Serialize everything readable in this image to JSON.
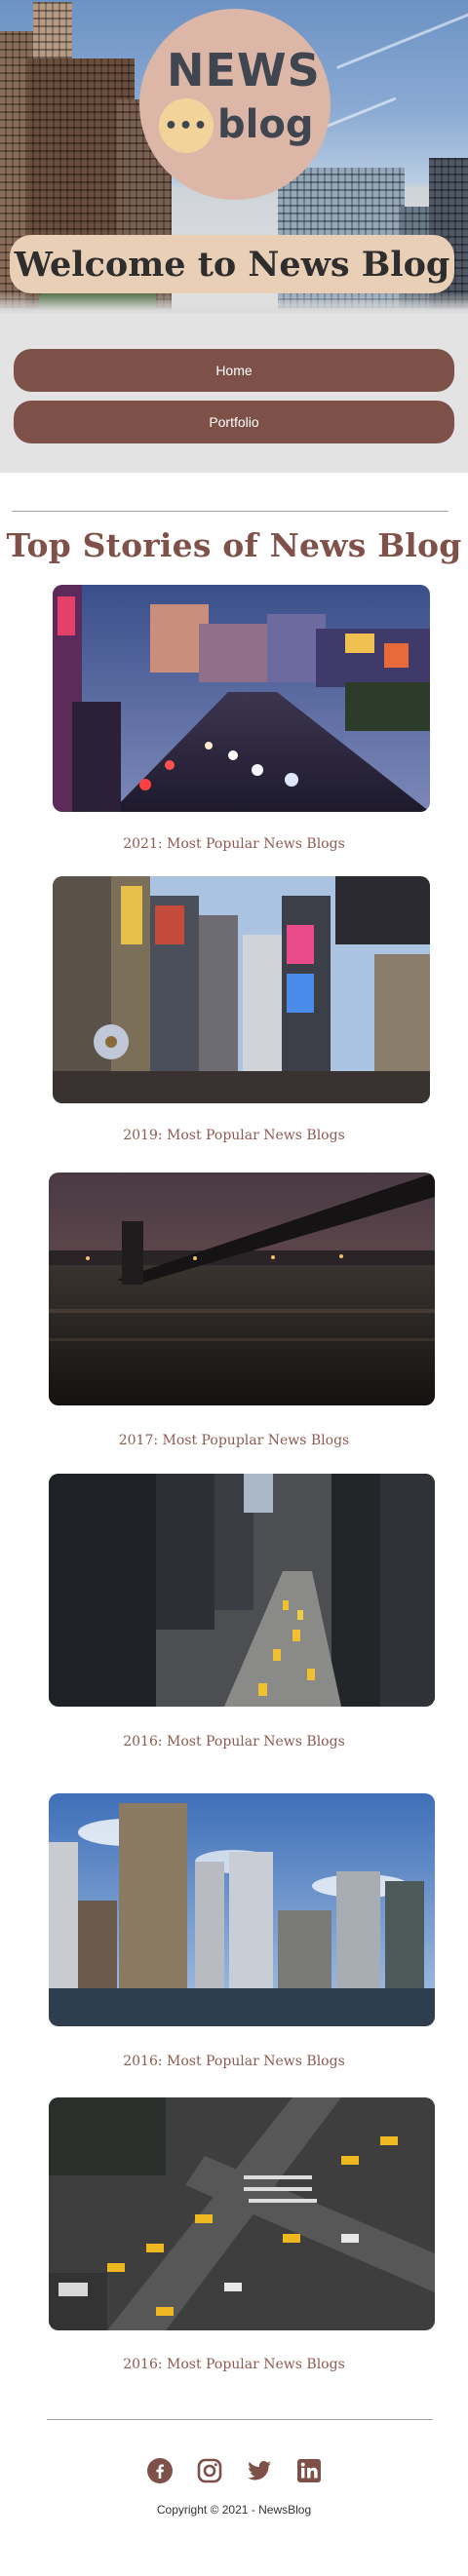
{
  "header": {
    "logo_news": "NEWS",
    "logo_blog": "blog",
    "logo_dots": "•••",
    "welcome": "Welcome to News Blog"
  },
  "nav": {
    "items": [
      {
        "label": "Home"
      },
      {
        "label": "Portfolio"
      }
    ]
  },
  "main": {
    "section_title": "Top Stories of News Blog",
    "stories": [
      {
        "caption": "2021: Most Popular News Blogs",
        "scene": "las-vegas-strip-night"
      },
      {
        "caption": "2019: Most Popular News Blogs",
        "scene": "times-square-billboards"
      },
      {
        "caption": "2017: Most Popuplar News Blogs",
        "scene": "bridge-over-river-night"
      },
      {
        "caption": "2016: Most Popular News Blogs",
        "scene": "city-street-traffic-aerial"
      },
      {
        "caption": "2016: Most Popular News Blogs",
        "scene": "manhattan-skyline-water"
      },
      {
        "caption": "2016: Most Popular News Blogs",
        "scene": "intersection-taxis-aerial"
      }
    ]
  },
  "footer": {
    "copyright": "Copyright © 2021 - NewsBlog",
    "socials": [
      "facebook-icon",
      "instagram-icon",
      "twitter-icon",
      "linkedin-icon"
    ]
  },
  "colors": {
    "accent": "#7d5048",
    "title": "#7f5148",
    "caption": "#8d5b50",
    "welcome_band": "#e9cfb6",
    "logo_circle": "#dcb6a6"
  }
}
